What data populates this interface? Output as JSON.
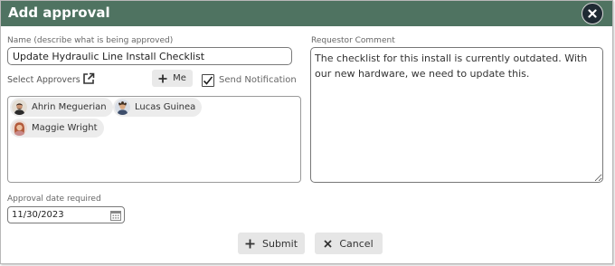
{
  "dialog": {
    "title": "Add approval"
  },
  "form": {
    "name_label": "Name (describe what is being approved)",
    "name_value": "Update Hydraulic Line Install Checklist",
    "approvers_label": "Select Approvers",
    "me_button_label": "Me",
    "send_notification_label": "Send Notification",
    "send_notification_checked": true,
    "approvers": [
      {
        "name": "Ahrin Meguerian",
        "avatar_icon": "person-avatar-dark-hair"
      },
      {
        "name": "Lucas Guinea",
        "avatar_icon": "person-avatar-curly-hair"
      },
      {
        "name": "Maggie Wright",
        "avatar_icon": "person-avatar-red-hair"
      }
    ],
    "comment_label": "Requestor Comment",
    "comment_value": "The checklist for this install is currently outdated. With our new hardware, we need to update this.",
    "date_label": "Approval date required",
    "date_value": "11/30/2023"
  },
  "actions": {
    "submit_label": "Submit",
    "cancel_label": "Cancel"
  },
  "colors": {
    "titlebar": "#4f7361",
    "close_button": "#1f2a33",
    "button_bg": "#e6e6e6"
  }
}
